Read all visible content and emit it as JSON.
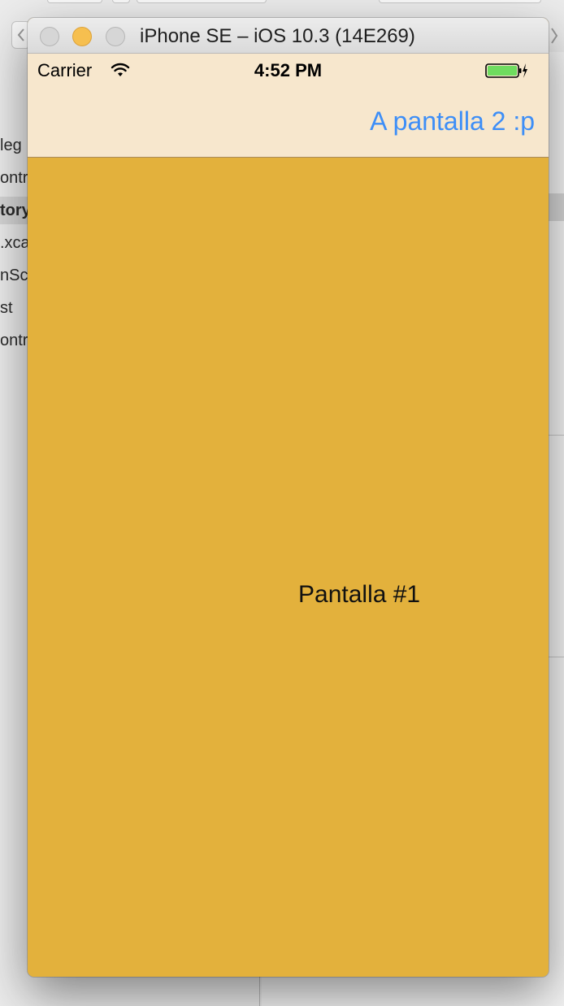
{
  "background_app": {
    "sidebar": {
      "items": [
        {
          "label": "leg",
          "selected": false
        },
        {
          "label": "ontr",
          "selected": false
        },
        {
          "label": "tory",
          "selected": true
        },
        {
          "label": ".xca",
          "selected": false
        },
        {
          "label": "nSc",
          "selected": false
        },
        {
          "label": "st",
          "selected": false
        },
        {
          "label": "ontr",
          "selected": false
        }
      ]
    }
  },
  "simulator": {
    "window_title": "iPhone SE – iOS 10.3 (14E269)",
    "status_bar": {
      "carrier": "Carrier",
      "time": "4:52 PM",
      "wifi_icon": "wifi-icon",
      "battery_icon": "battery-charging-icon"
    },
    "nav_bar": {
      "right_button_label": "A pantalla 2 :p"
    },
    "content": {
      "label": "Pantalla #1"
    },
    "colors": {
      "nav_background": "#f7e7cd",
      "content_background": "#e3b13c",
      "tint": "#3d8ef7",
      "battery_fill": "#6fdc5f"
    }
  }
}
